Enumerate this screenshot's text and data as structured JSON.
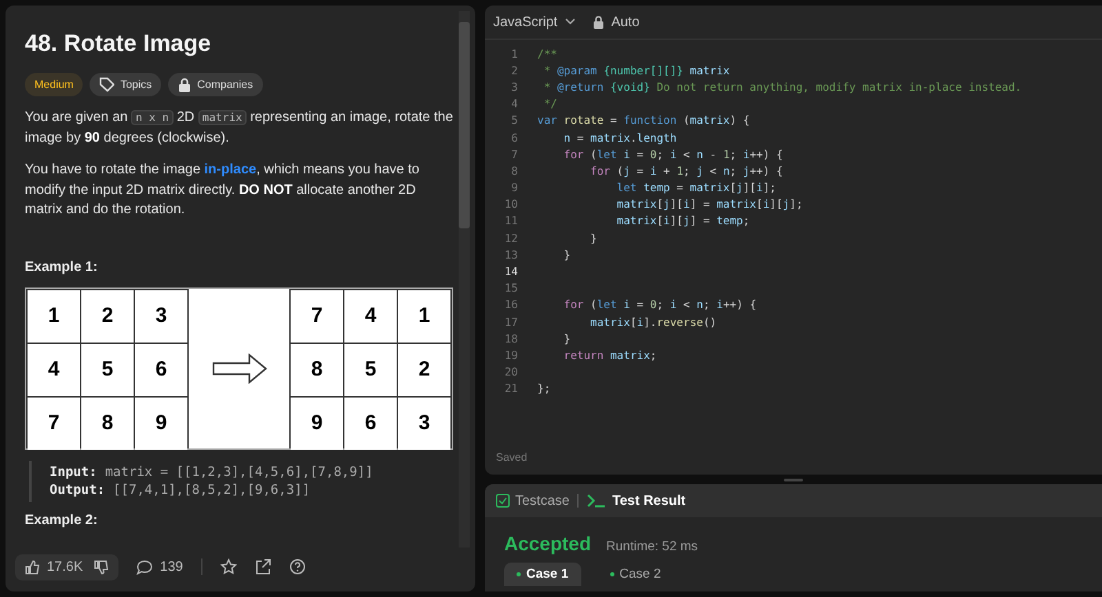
{
  "problem": {
    "title": "48. Rotate Image",
    "tags": [
      {
        "kind": "difficulty",
        "label": "Medium"
      },
      {
        "kind": "topics",
        "label": "Topics"
      },
      {
        "kind": "companies",
        "label": "Companies"
      }
    ],
    "paragraphs": [
      [
        {
          "kind": "text",
          "text": "You are given an "
        },
        {
          "kind": "code",
          "text": "n x n"
        },
        {
          "kind": "text",
          "text": " 2D "
        },
        {
          "kind": "code",
          "text": "matrix"
        },
        {
          "kind": "text",
          "text": " representing an image, rotate the image by **90** degrees (clockwise)."
        }
      ],
      [
        {
          "kind": "text",
          "text": "You have to rotate the image "
        },
        {
          "kind": "link",
          "text": "in-place"
        },
        {
          "kind": "text",
          "text": ", which means you have to modify the input 2D matrix directly. **DO NOT** allocate another 2D matrix and do the rotation."
        }
      ]
    ],
    "example1_title": "Example 1:",
    "example_image": {
      "before": [
        [
          "1",
          "2",
          "3"
        ],
        [
          "4",
          "5",
          "6"
        ],
        [
          "7",
          "8",
          "9"
        ]
      ],
      "after": [
        [
          "7",
          "4",
          "1"
        ],
        [
          "8",
          "5",
          "2"
        ],
        [
          "9",
          "6",
          "3"
        ]
      ]
    },
    "example_lines": [
      {
        "label": "Input:",
        "value": "matrix = [[1,2,3],[4,5,6],[7,8,9]]"
      },
      {
        "label": "Output:",
        "value": "[[7,4,1],[8,5,2],[9,6,3]]"
      }
    ],
    "example2_title": "Example 2:",
    "footer": {
      "likes": "17.6K",
      "comments": "139"
    }
  },
  "editor": {
    "language": "JavaScript",
    "mode": "Auto",
    "status": "Saved",
    "lines": [
      {
        "number": "1",
        "active": false,
        "tokens": [
          {
            "kind": "comment",
            "text": "/**"
          }
        ]
      },
      {
        "number": "2",
        "active": false,
        "tokens": [
          {
            "kind": "comment",
            "text": " * "
          },
          {
            "kind": "tag",
            "text": "@param"
          },
          {
            "kind": "type",
            "text": " {number[][]}"
          },
          {
            "kind": "ident",
            "text": " matrix"
          }
        ]
      },
      {
        "number": "3",
        "active": false,
        "tokens": [
          {
            "kind": "comment",
            "text": " * "
          },
          {
            "kind": "tag",
            "text": "@return"
          },
          {
            "kind": "type",
            "text": " {void}"
          },
          {
            "kind": "comment",
            "text": " Do not return anything, modify matrix in-place instead."
          }
        ]
      },
      {
        "number": "4",
        "active": false,
        "tokens": [
          {
            "kind": "comment",
            "text": " */"
          }
        ]
      },
      {
        "number": "5",
        "active": false,
        "tokens": [
          {
            "kind": "keyword",
            "text": "var"
          },
          {
            "kind": "func",
            "text": " rotate"
          },
          {
            "kind": "plain",
            "text": " = "
          },
          {
            "kind": "keyword",
            "text": "function"
          },
          {
            "kind": "plain",
            "text": " ("
          },
          {
            "kind": "ident",
            "text": "matrix"
          },
          {
            "kind": "plain",
            "text": ") {"
          }
        ]
      },
      {
        "number": "6",
        "active": false,
        "tokens": [
          {
            "kind": "ident",
            "text": "    n"
          },
          {
            "kind": "plain",
            "text": " = "
          },
          {
            "kind": "ident",
            "text": "matrix"
          },
          {
            "kind": "plain",
            "text": "."
          },
          {
            "kind": "ident",
            "text": "length"
          }
        ]
      },
      {
        "number": "7",
        "active": false,
        "tokens": [
          {
            "kind": "control",
            "text": "    for"
          },
          {
            "kind": "plain",
            "text": " ("
          },
          {
            "kind": "keyword",
            "text": "let"
          },
          {
            "kind": "ident",
            "text": " i"
          },
          {
            "kind": "plain",
            "text": " = "
          },
          {
            "kind": "number",
            "text": "0"
          },
          {
            "kind": "plain",
            "text": "; "
          },
          {
            "kind": "ident",
            "text": "i"
          },
          {
            "kind": "plain",
            "text": " < "
          },
          {
            "kind": "ident",
            "text": "n"
          },
          {
            "kind": "plain",
            "text": " - "
          },
          {
            "kind": "number",
            "text": "1"
          },
          {
            "kind": "plain",
            "text": "; "
          },
          {
            "kind": "ident",
            "text": "i"
          },
          {
            "kind": "plain",
            "text": "++) {"
          }
        ]
      },
      {
        "number": "8",
        "active": false,
        "tokens": [
          {
            "kind": "control",
            "text": "        for"
          },
          {
            "kind": "plain",
            "text": " ("
          },
          {
            "kind": "ident",
            "text": "j"
          },
          {
            "kind": "plain",
            "text": " = "
          },
          {
            "kind": "ident",
            "text": "i"
          },
          {
            "kind": "plain",
            "text": " + "
          },
          {
            "kind": "number",
            "text": "1"
          },
          {
            "kind": "plain",
            "text": "; "
          },
          {
            "kind": "ident",
            "text": "j"
          },
          {
            "kind": "plain",
            "text": " < "
          },
          {
            "kind": "ident",
            "text": "n"
          },
          {
            "kind": "plain",
            "text": "; "
          },
          {
            "kind": "ident",
            "text": "j"
          },
          {
            "kind": "plain",
            "text": "++) {"
          }
        ]
      },
      {
        "number": "9",
        "active": false,
        "tokens": [
          {
            "kind": "keyword",
            "text": "            let"
          },
          {
            "kind": "ident",
            "text": " temp"
          },
          {
            "kind": "plain",
            "text": " = "
          },
          {
            "kind": "ident",
            "text": "matrix"
          },
          {
            "kind": "plain",
            "text": "["
          },
          {
            "kind": "ident",
            "text": "j"
          },
          {
            "kind": "plain",
            "text": "]["
          },
          {
            "kind": "ident",
            "text": "i"
          },
          {
            "kind": "plain",
            "text": "];"
          }
        ]
      },
      {
        "number": "10",
        "active": false,
        "tokens": [
          {
            "kind": "ident",
            "text": "            matrix"
          },
          {
            "kind": "plain",
            "text": "["
          },
          {
            "kind": "ident",
            "text": "j"
          },
          {
            "kind": "plain",
            "text": "]["
          },
          {
            "kind": "ident",
            "text": "i"
          },
          {
            "kind": "plain",
            "text": "] = "
          },
          {
            "kind": "ident",
            "text": "matrix"
          },
          {
            "kind": "plain",
            "text": "["
          },
          {
            "kind": "ident",
            "text": "i"
          },
          {
            "kind": "plain",
            "text": "]["
          },
          {
            "kind": "ident",
            "text": "j"
          },
          {
            "kind": "plain",
            "text": "];"
          }
        ]
      },
      {
        "number": "11",
        "active": false,
        "tokens": [
          {
            "kind": "ident",
            "text": "            matrix"
          },
          {
            "kind": "plain",
            "text": "["
          },
          {
            "kind": "ident",
            "text": "i"
          },
          {
            "kind": "plain",
            "text": "]["
          },
          {
            "kind": "ident",
            "text": "j"
          },
          {
            "kind": "plain",
            "text": "] = "
          },
          {
            "kind": "ident",
            "text": "temp"
          },
          {
            "kind": "plain",
            "text": ";"
          }
        ]
      },
      {
        "number": "12",
        "active": false,
        "tokens": [
          {
            "kind": "plain",
            "text": "        }"
          }
        ]
      },
      {
        "number": "13",
        "active": false,
        "tokens": [
          {
            "kind": "plain",
            "text": "    }"
          }
        ]
      },
      {
        "number": "14",
        "active": true
      },
      {
        "number": "15",
        "active": false
      },
      {
        "number": "16",
        "active": false,
        "tokens": [
          {
            "kind": "control",
            "text": "    for"
          },
          {
            "kind": "plain",
            "text": " ("
          },
          {
            "kind": "keyword",
            "text": "let"
          },
          {
            "kind": "ident",
            "text": " i"
          },
          {
            "kind": "plain",
            "text": " = "
          },
          {
            "kind": "number",
            "text": "0"
          },
          {
            "kind": "plain",
            "text": "; "
          },
          {
            "kind": "ident",
            "text": "i"
          },
          {
            "kind": "plain",
            "text": " < "
          },
          {
            "kind": "ident",
            "text": "n"
          },
          {
            "kind": "plain",
            "text": "; "
          },
          {
            "kind": "ident",
            "text": "i"
          },
          {
            "kind": "plain",
            "text": "++) {"
          }
        ]
      },
      {
        "number": "17",
        "active": false,
        "tokens": [
          {
            "kind": "ident",
            "text": "        matrix"
          },
          {
            "kind": "plain",
            "text": "["
          },
          {
            "kind": "ident",
            "text": "i"
          },
          {
            "kind": "plain",
            "text": "]."
          },
          {
            "kind": "func",
            "text": "reverse"
          },
          {
            "kind": "plain",
            "text": "()"
          }
        ]
      },
      {
        "number": "18",
        "active": false,
        "tokens": [
          {
            "kind": "plain",
            "text": "    }"
          }
        ]
      },
      {
        "number": "19",
        "active": false,
        "tokens": [
          {
            "kind": "control",
            "text": "    return"
          },
          {
            "kind": "ident",
            "text": " matrix"
          },
          {
            "kind": "plain",
            "text": ";"
          }
        ]
      },
      {
        "number": "20",
        "active": false
      },
      {
        "number": "21",
        "active": false,
        "tokens": [
          {
            "kind": "plain",
            "text": "};"
          }
        ]
      }
    ]
  },
  "results": {
    "tabs": [
      {
        "kind": "testcase",
        "label": "Testcase",
        "selected": false
      },
      {
        "kind": "result",
        "label": "Test Result",
        "selected": true
      }
    ],
    "verdict": "Accepted",
    "runtime": "Runtime: 52 ms",
    "cases": [
      {
        "label": "Case 1",
        "selected": true,
        "color": "#2cbb5d"
      },
      {
        "label": "Case 2",
        "selected": false,
        "color": "#2cbb5d"
      }
    ]
  }
}
